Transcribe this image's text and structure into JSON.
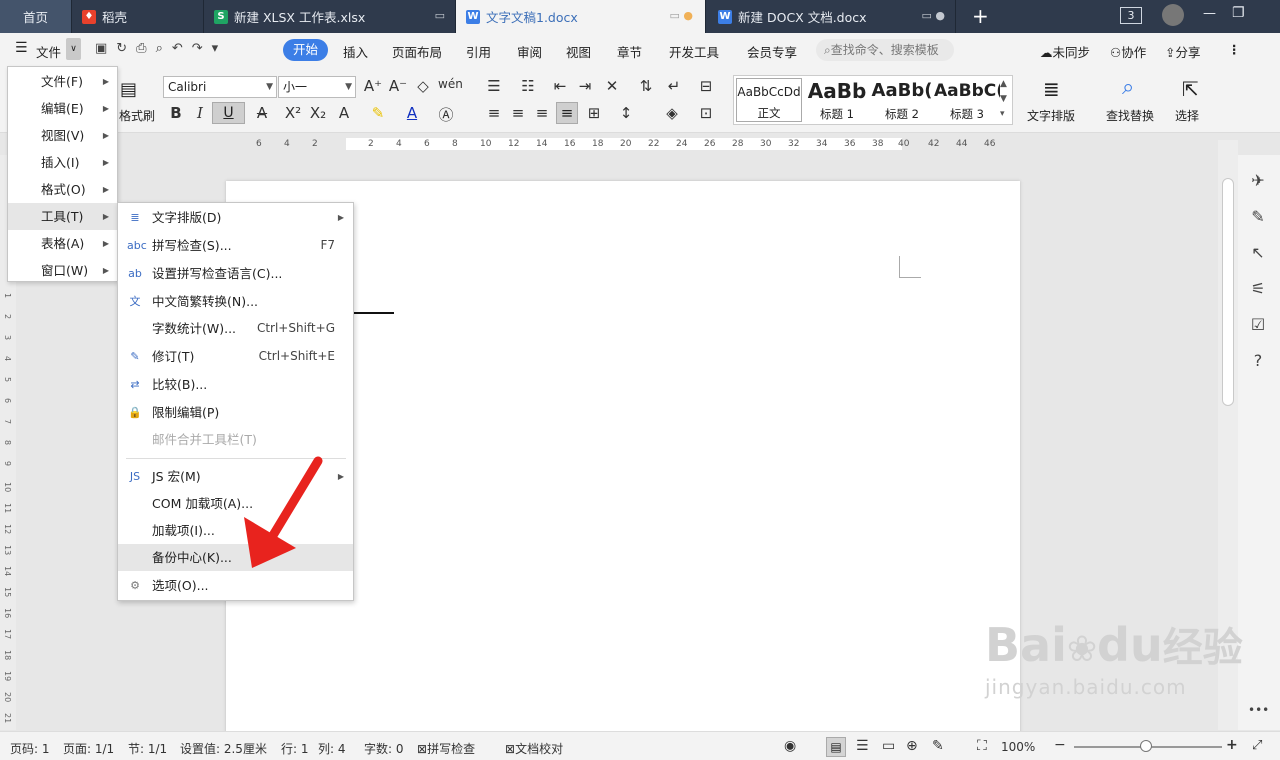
{
  "tabs": [
    {
      "label": "首页"
    },
    {
      "label": "稻壳"
    },
    {
      "label": "新建 XLSX 工作表.xlsx"
    },
    {
      "label": "文字文稿1.docx"
    },
    {
      "label": "新建 DOCX 文档.docx"
    }
  ],
  "titlebar": {
    "add": "+",
    "badge": "3",
    "min": "—",
    "restore": "❐"
  },
  "menubar": {
    "file": "文件",
    "items": [
      "开始",
      "插入",
      "页面布局",
      "引用",
      "审阅",
      "视图",
      "章节",
      "开发工具",
      "会员专享"
    ],
    "search_placeholder": "查找命令、搜索模板",
    "sync": "未同步",
    "collab": "协作",
    "share": "分享"
  },
  "ribbon": {
    "font": "Calibri",
    "size": "小一",
    "format_brush": "格式刷",
    "styles": [
      {
        "preview": "AaBbCcDd",
        "label": "正文"
      },
      {
        "preview": "AaBb",
        "label": "标题 1"
      },
      {
        "preview": "AaBb(",
        "label": "标题 2"
      },
      {
        "preview": "AaBbC(",
        "label": "标题 3"
      }
    ],
    "text_layout": "文字排版",
    "find_replace": "查找替换",
    "select": "选择"
  },
  "ruler_ticks": [
    "6",
    "4",
    "2",
    "2",
    "4",
    "6",
    "8",
    "10",
    "12",
    "14",
    "16",
    "18",
    "20",
    "22",
    "24",
    "26",
    "28",
    "30",
    "32",
    "34",
    "36",
    "38",
    "40",
    "42",
    "44",
    "46"
  ],
  "vruler_ticks": [
    "1",
    "2",
    "3",
    "4",
    "5",
    "6",
    "7",
    "8",
    "9",
    "10",
    "11",
    "12",
    "13",
    "14",
    "15",
    "16",
    "17",
    "18",
    "19",
    "20",
    "21"
  ],
  "file_menu": [
    {
      "label": "文件(F)"
    },
    {
      "label": "编辑(E)"
    },
    {
      "label": "视图(V)"
    },
    {
      "label": "插入(I)"
    },
    {
      "label": "格式(O)"
    },
    {
      "label": "工具(T)"
    },
    {
      "label": "表格(A)"
    },
    {
      "label": "窗口(W)"
    }
  ],
  "tools_menu": [
    {
      "label": "文字排版(D)",
      "shortcut": ""
    },
    {
      "label": "拼写检查(S)...",
      "shortcut": "F7"
    },
    {
      "label": "设置拼写检查语言(C)...",
      "shortcut": ""
    },
    {
      "label": "中文简繁转换(N)...",
      "shortcut": ""
    },
    {
      "label": "字数统计(W)...",
      "shortcut": "Ctrl+Shift+G"
    },
    {
      "label": "修订(T)",
      "shortcut": "Ctrl+Shift+E"
    },
    {
      "label": "比较(B)...",
      "shortcut": ""
    },
    {
      "label": "限制编辑(P)",
      "shortcut": ""
    },
    {
      "label": "邮件合并工具栏(T)",
      "shortcut": ""
    },
    {
      "label": "JS 宏(M)",
      "shortcut": ""
    },
    {
      "label": "COM 加载项(A)...",
      "shortcut": ""
    },
    {
      "label": "加载项(I)...",
      "shortcut": ""
    },
    {
      "label": "备份中心(K)...",
      "shortcut": ""
    },
    {
      "label": "选项(O)...",
      "shortcut": ""
    }
  ],
  "status": {
    "page": "页码: 1",
    "pages": "页面: 1/1",
    "section": "节: 1/1",
    "setting": "设置值: 2.5厘米",
    "row": "行: 1",
    "col": "列: 4",
    "words": "字数: 0",
    "spell": "拼写检查",
    "proof": "文档校对",
    "zoom": "100%"
  },
  "watermark": {
    "brand": "Bai",
    "brand2": "du",
    "cn": "经验",
    "url": "jingyan.baidu.com"
  },
  "colors": {
    "accent": "#3c7ee6",
    "titlebar": "#2f3a4c",
    "arrow": "#e8231e"
  }
}
